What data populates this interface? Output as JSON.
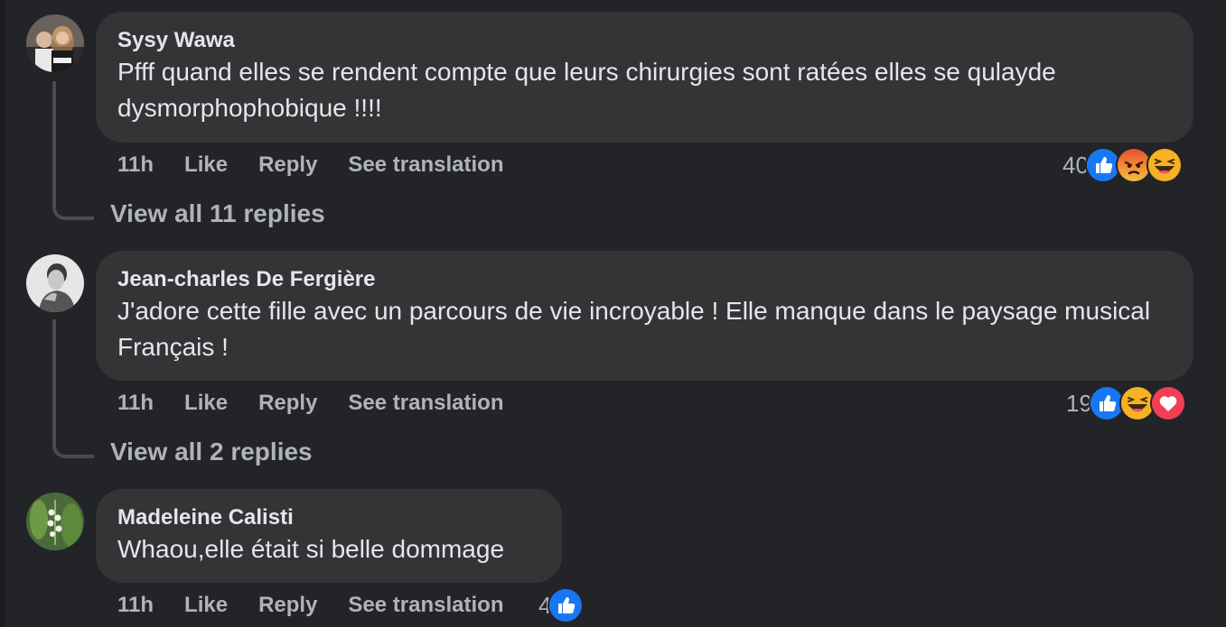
{
  "comments": [
    {
      "author": "Sysy Wawa",
      "text": "Pfff quand elles se rendent compte que leurs chirurgies sont ratées elles se qulayde dysmorphophobique !!!!",
      "time": "11h",
      "like": "Like",
      "reply": "Reply",
      "translate": "See translation",
      "reaction_count": "40",
      "reactions": [
        "like-icon",
        "angry-icon",
        "haha-icon"
      ],
      "view_replies": "View all 11 replies"
    },
    {
      "author": "Jean-charles De Fergière",
      "text": "J'adore cette fille avec un parcours de vie incroyable ! Elle manque dans le paysage musical Français !",
      "time": "11h",
      "like": "Like",
      "reply": "Reply",
      "translate": "See translation",
      "reaction_count": "19",
      "reactions": [
        "like-icon",
        "haha-icon",
        "love-icon"
      ],
      "view_replies": "View all 2 replies"
    },
    {
      "author": "Madeleine Calisti",
      "text": "Whaou,elle était si belle dommage",
      "time": "11h",
      "like": "Like",
      "reply": "Reply",
      "translate": "See translation",
      "reaction_count": "4",
      "reactions": [
        "like-icon"
      ]
    }
  ],
  "colors": {
    "background": "#232427",
    "bubble": "#333436",
    "text_primary": "#e4e6eb",
    "text_secondary": "#b0b3b8",
    "like_blue": "#1877f2",
    "angry_orange": "#e9710f",
    "haha_yellow": "#f7b125",
    "love_red": "#f33e58"
  }
}
